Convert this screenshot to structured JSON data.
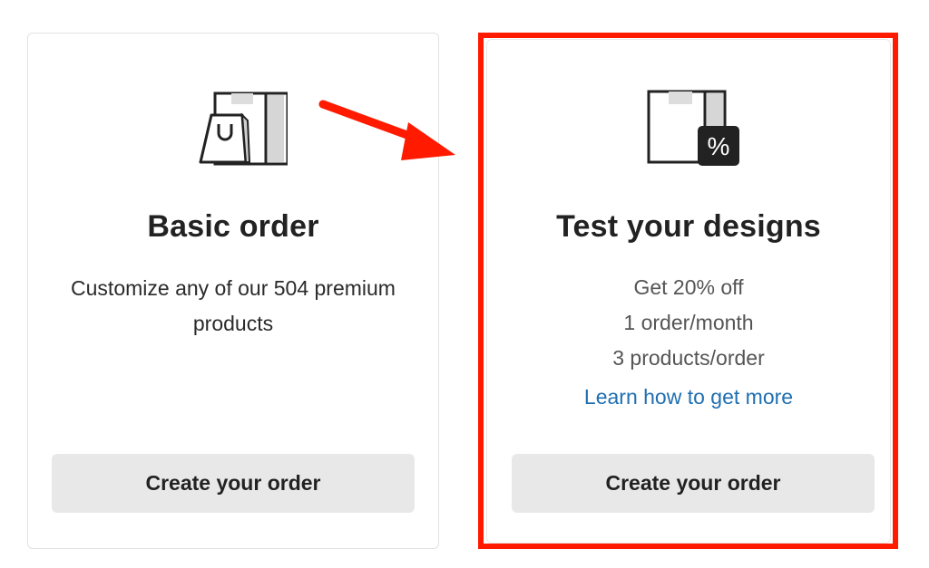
{
  "cards": [
    {
      "id": "basic",
      "icon": "shopping-bag-box-icon",
      "title": "Basic order",
      "description": "Customize any of our 504 premium products",
      "button_label": "Create your order"
    },
    {
      "id": "test",
      "icon": "discount-box-icon",
      "title": "Test your designs",
      "features": [
        "Get 20% off",
        "1 order/month",
        "3 products/order"
      ],
      "link_label": "Learn how to get more",
      "button_label": "Create your order",
      "percent_glyph": "%"
    }
  ],
  "annotation": {
    "arrow_icon": "red-arrow-icon",
    "highlight_color": "#ff1a00"
  },
  "colors": {
    "link": "#1f6fb2",
    "button_bg": "#e8e8e8"
  }
}
